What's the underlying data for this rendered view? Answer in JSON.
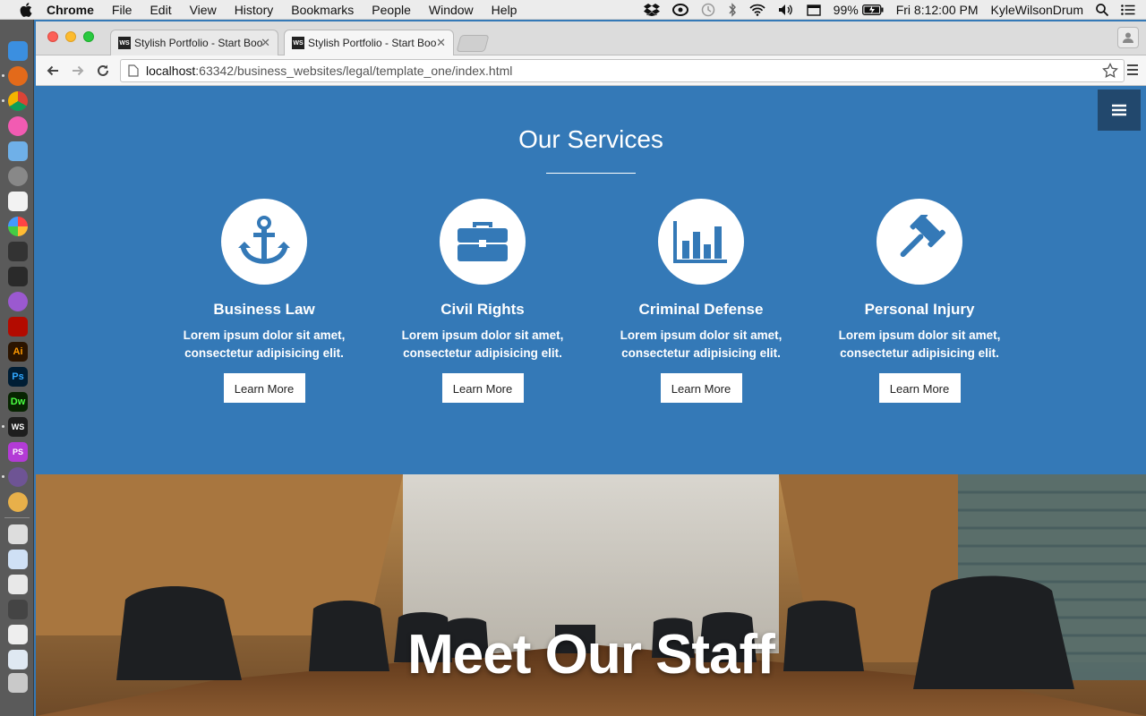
{
  "menubar": {
    "app_name": "Chrome",
    "items": [
      "File",
      "Edit",
      "View",
      "History",
      "Bookmarks",
      "People",
      "Window",
      "Help"
    ],
    "battery": "99%",
    "clock": "Fri 8:12:00 PM",
    "user": "KyleWilsonDrum"
  },
  "browser": {
    "tabs": [
      {
        "favicon": "WS",
        "title": "Stylish Portfolio - Start Boo"
      },
      {
        "favicon": "WS",
        "title": "Stylish Portfolio - Start Boo"
      }
    ],
    "url_host": "localhost",
    "url_rest": ":63342/business_websites/legal/template_one/index.html"
  },
  "services": {
    "heading": "Our Services",
    "items": [
      {
        "icon": "anchor-icon",
        "title": "Business Law",
        "text": "Lorem ipsum dolor sit amet, consectetur adipisicing elit.",
        "button": "Learn More"
      },
      {
        "icon": "briefcase-icon",
        "title": "Civil Rights",
        "text": "Lorem ipsum dolor sit amet, consectetur adipisicing elit.",
        "button": "Learn More"
      },
      {
        "icon": "bar-chart-icon",
        "title": "Criminal Defense",
        "text": "Lorem ipsum dolor sit amet, consectetur adipisicing elit.",
        "button": "Learn More"
      },
      {
        "icon": "gavel-icon",
        "title": "Personal Injury",
        "text": "Lorem ipsum dolor sit amet, consectetur adipisicing elit.",
        "button": "Learn More"
      }
    ]
  },
  "staff": {
    "heading": "Meet Our Staff"
  },
  "colors": {
    "primary": "#3479b7",
    "nav_toggle": "#22486d",
    "white": "#ffffff"
  }
}
